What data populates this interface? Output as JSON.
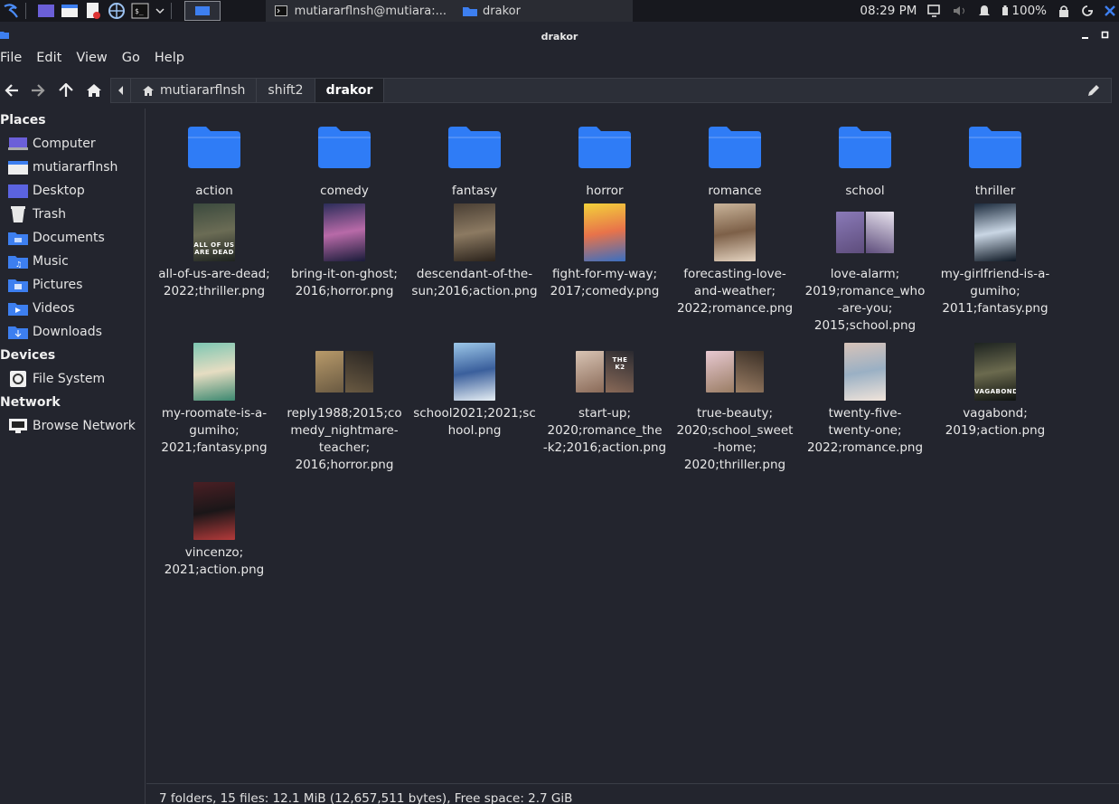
{
  "panel": {
    "terminal_task": "mutiararflnsh@mutiara:...",
    "files_task": "drakor",
    "clock": "08:29 PM",
    "battery": "100%"
  },
  "window": {
    "title": "drakor"
  },
  "menu": [
    "File",
    "Edit",
    "View",
    "Go",
    "Help"
  ],
  "pathbar": [
    "mutiararflnsh",
    "shift2",
    "drakor"
  ],
  "sidebar": {
    "places_heading": "Places",
    "places": [
      {
        "label": "Computer",
        "icon": "computer-icon"
      },
      {
        "label": "mutiararflnsh",
        "icon": "home-folder-icon"
      },
      {
        "label": "Desktop",
        "icon": "desktop-icon"
      },
      {
        "label": "Trash",
        "icon": "trash-icon"
      },
      {
        "label": "Documents",
        "icon": "documents-folder-icon"
      },
      {
        "label": "Music",
        "icon": "music-folder-icon"
      },
      {
        "label": "Pictures",
        "icon": "pictures-folder-icon"
      },
      {
        "label": "Videos",
        "icon": "videos-folder-icon"
      },
      {
        "label": "Downloads",
        "icon": "downloads-folder-icon"
      }
    ],
    "devices_heading": "Devices",
    "devices": [
      {
        "label": "File System",
        "icon": "drive-icon"
      }
    ],
    "network_heading": "Network",
    "network": [
      {
        "label": "Browse Network",
        "icon": "network-icon"
      }
    ]
  },
  "folders": [
    "action",
    "comedy",
    "fantasy",
    "horror",
    "romance",
    "school",
    "thriller"
  ],
  "files": [
    {
      "label": "all-of-us-are-dead;\n2022;thriller.png",
      "poster": [
        "#3b4a3e",
        "#6b6c55",
        "#1e2320"
      ],
      "layout": "tall",
      "caption": "ALL OF US ARE DEAD"
    },
    {
      "label": "bring-it-on-ghost;\n2016;horror.png",
      "poster": [
        "#2b2d5a",
        "#b86aa8",
        "#1a1c3a"
      ],
      "layout": "tall",
      "caption": ""
    },
    {
      "label": "descendant-of-the-\nsun;2016;action.png",
      "poster": [
        "#4a3f34",
        "#8c7a62",
        "#2a221b"
      ],
      "layout": "tall",
      "caption": ""
    },
    {
      "label": "fight-for-my-way;\n2017;comedy.png",
      "poster": [
        "#f3d23a",
        "#e8734a",
        "#3a6fc2"
      ],
      "layout": "tall",
      "caption": ""
    },
    {
      "label": "forecasting-love-\nand-weather;\n2022;romance.png",
      "poster": [
        "#c9b49a",
        "#7d6048",
        "#e5d4c1"
      ],
      "layout": "tall",
      "caption": ""
    },
    {
      "label": "love-alarm;\n2019;romance_who\n-are-you;\n2015;school.png",
      "poster": [
        "#8a7ab8",
        "#e9e4ef",
        "#5e4d7c"
      ],
      "layout": "wide",
      "caption": ""
    },
    {
      "label": "my-girlfriend-is-a-\ngumiho;\n2011;fantasy.png",
      "poster": [
        "#1b2a3c",
        "#c9d6e4",
        "#0c1622"
      ],
      "layout": "tall",
      "caption": ""
    },
    {
      "label": "my-roomate-is-a-\ngumiho;\n2021;fantasy.png",
      "poster": [
        "#7dc6b2",
        "#e6ddc2",
        "#3c8870"
      ],
      "layout": "tall",
      "caption": ""
    },
    {
      "label": "reply1988;2015;co\nmedy_nightmare-\nteacher;\n2016;horror.png",
      "poster": [
        "#b89a6a",
        "#2a2623",
        "#6a5a42"
      ],
      "layout": "wide",
      "caption": ""
    },
    {
      "label": "school2021;2021;sc\nhool.png",
      "poster": [
        "#9cc7e8",
        "#3a5f9c",
        "#e5eef4"
      ],
      "layout": "tall",
      "caption": ""
    },
    {
      "label": "start-up;\n2020;romance_the\n-k2;2016;action.png",
      "poster": [
        "#d8c4b4",
        "#2a2a30",
        "#8a6a58"
      ],
      "layout": "wide",
      "caption": "THE K2"
    },
    {
      "label": "true-beauty;\n2020;school_sweet\n-home;\n2020;thriller.png",
      "poster": [
        "#e8c9d2",
        "#3a2f26",
        "#9a7d64"
      ],
      "layout": "wide",
      "caption": ""
    },
    {
      "label": "twenty-five-\ntwenty-one;\n2022;romance.png",
      "poster": [
        "#d7c3b9",
        "#9ab0c4",
        "#f1e4da"
      ],
      "layout": "tall",
      "caption": ""
    },
    {
      "label": "vagabond;\n2019;action.png",
      "poster": [
        "#1d2320",
        "#6b6a4e",
        "#0e1210"
      ],
      "layout": "tall",
      "caption": "VAGABOND"
    },
    {
      "label": "vincenzo;\n2021;action.png",
      "poster": [
        "#4a1f24",
        "#1a1618",
        "#b33a3a"
      ],
      "layout": "tall",
      "caption": ""
    }
  ],
  "status": "7 folders, 15 files: 12.1 MiB (12,657,511 bytes), Free space: 2.7 GiB",
  "colors": {
    "accent": "#3d7ff0",
    "folder": "#2f7cf6",
    "background": "#23252e"
  }
}
